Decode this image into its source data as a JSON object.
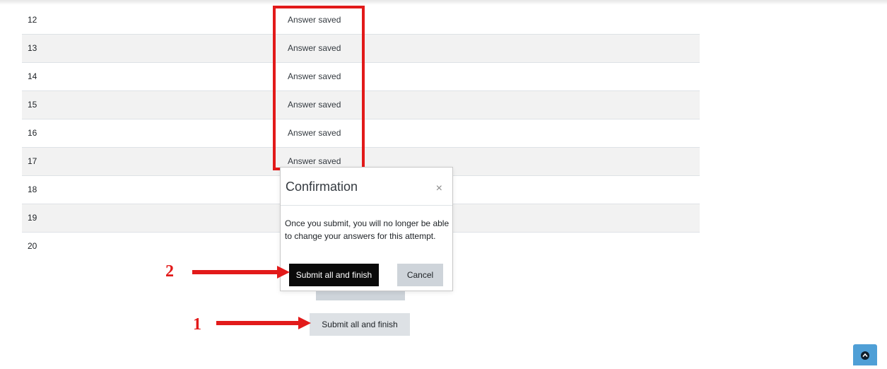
{
  "rows": [
    {
      "number": "12",
      "status": "Answer saved"
    },
    {
      "number": "13",
      "status": "Answer saved"
    },
    {
      "number": "14",
      "status": "Answer saved"
    },
    {
      "number": "15",
      "status": "Answer saved"
    },
    {
      "number": "16",
      "status": "Answer saved"
    },
    {
      "number": "17",
      "status": "Answer saved"
    },
    {
      "number": "18",
      "status": ""
    },
    {
      "number": "19",
      "status": ""
    },
    {
      "number": "20",
      "status": ""
    }
  ],
  "modal": {
    "title": "Confirmation",
    "close_glyph": "×",
    "body": "Once you submit, you will no longer be able to change your answers for this attempt.",
    "submit_label": "Submit all and finish",
    "cancel_label": "Cancel"
  },
  "page": {
    "submit_label": "Submit all and finish"
  },
  "annotations": {
    "step1": "1",
    "step2": "2",
    "color": "#e21a1a"
  },
  "icons": {
    "scroll_top": "chevron-up-icon",
    "scroll_top_color": "#4f9fd6"
  }
}
